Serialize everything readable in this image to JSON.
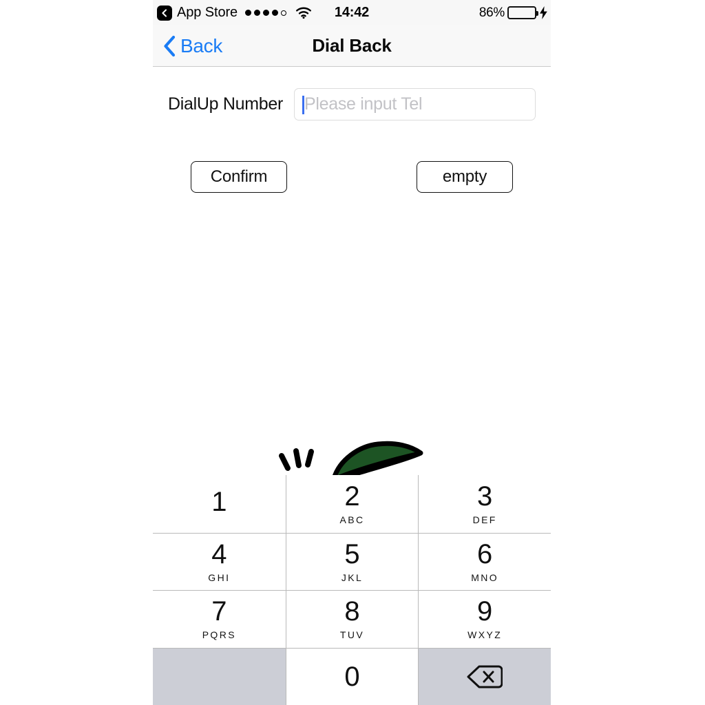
{
  "status_bar": {
    "back_chip_icon": "chevron-left-icon",
    "carrier_label": "App Store",
    "signal_icon": "signal-dots-icon",
    "signal_dots_filled": 4,
    "signal_dots_total": 5,
    "wifi_icon": "wifi-icon",
    "time": "14:42",
    "battery_percent": "86%",
    "battery_level": 86,
    "battery_fill_color": "#4cd964",
    "charging_icon": "lightning-bolt-icon"
  },
  "nav_bar": {
    "back_icon": "chevron-left-icon",
    "back_label": "Back",
    "title": "Dial Back",
    "accent_color": "#1a7cf5"
  },
  "form": {
    "field_label": "DialUp Number",
    "tel_input": {
      "value": "",
      "placeholder": "Please input Tel",
      "caret_color": "#3a6ff0",
      "focused": true
    }
  },
  "actions": {
    "confirm_label": "Confirm",
    "empty_label": "empty"
  },
  "decoration": {
    "leaf_icon": "leaf-icon",
    "leaf_color": "#1d5424",
    "outline_color": "#000000",
    "sparkle_icon": "sparkle-lines-icon"
  },
  "keypad": {
    "keys": [
      {
        "digit": "1",
        "letters": "",
        "style": "white",
        "name": "key-1"
      },
      {
        "digit": "2",
        "letters": "ABC",
        "style": "white",
        "name": "key-2"
      },
      {
        "digit": "3",
        "letters": "DEF",
        "style": "white",
        "name": "key-3"
      },
      {
        "digit": "4",
        "letters": "GHI",
        "style": "white",
        "name": "key-4"
      },
      {
        "digit": "5",
        "letters": "JKL",
        "style": "white",
        "name": "key-5"
      },
      {
        "digit": "6",
        "letters": "MNO",
        "style": "white",
        "name": "key-6"
      },
      {
        "digit": "7",
        "letters": "PQRS",
        "style": "white",
        "name": "key-7"
      },
      {
        "digit": "8",
        "letters": "TUV",
        "style": "white",
        "name": "key-8"
      },
      {
        "digit": "9",
        "letters": "WXYZ",
        "style": "white",
        "name": "key-9"
      },
      {
        "digit": "",
        "letters": "",
        "style": "gray",
        "name": "key-blank"
      },
      {
        "digit": "0",
        "letters": "",
        "style": "white",
        "name": "key-0"
      },
      {
        "digit": "",
        "letters": "",
        "style": "gray",
        "name": "key-backspace",
        "icon": "backspace-icon"
      }
    ],
    "gray_key_color": "#ccced6",
    "separator_color": "#b9b9b9"
  }
}
